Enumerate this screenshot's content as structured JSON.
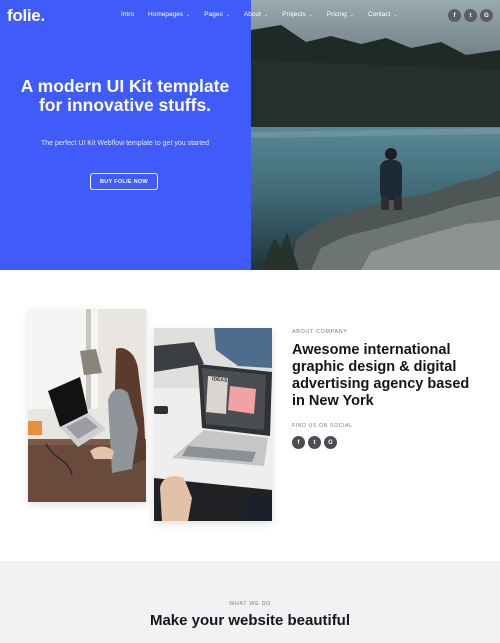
{
  "brand": {
    "logo": "folie."
  },
  "nav": {
    "items": [
      {
        "label": "Intro",
        "dropdown": false
      },
      {
        "label": "Homepages",
        "dropdown": true
      },
      {
        "label": "Pages",
        "dropdown": true
      },
      {
        "label": "About",
        "dropdown": true
      },
      {
        "label": "Projects",
        "dropdown": true
      },
      {
        "label": "Pricing",
        "dropdown": true
      },
      {
        "label": "Contact",
        "dropdown": true
      }
    ],
    "social": [
      {
        "icon": "facebook-icon",
        "glyph": "f"
      },
      {
        "icon": "twitter-icon",
        "glyph": "t"
      },
      {
        "icon": "google-icon",
        "glyph": "G"
      }
    ]
  },
  "hero": {
    "title": "A modern UI Kit template for innovative stuffs.",
    "subtitle": "The perfect UI Kit Webflow template to get you started",
    "button_label": "BUY FOLIE NOW",
    "accent_color": "#3f5cfb"
  },
  "about": {
    "eyebrow": "ABOUT COMPANY",
    "title": "Awesome international graphic design & digital advertising agency based in New York",
    "find_us": "FIND US ON SOCIAL",
    "screen_label": "IDEAS",
    "social": [
      {
        "icon": "facebook-icon",
        "glyph": "f"
      },
      {
        "icon": "twitter-icon",
        "glyph": "t"
      },
      {
        "icon": "google-icon",
        "glyph": "G"
      }
    ]
  },
  "what_we_do": {
    "eyebrow": "WHAT WE DO",
    "title": "Make your website beautiful"
  }
}
